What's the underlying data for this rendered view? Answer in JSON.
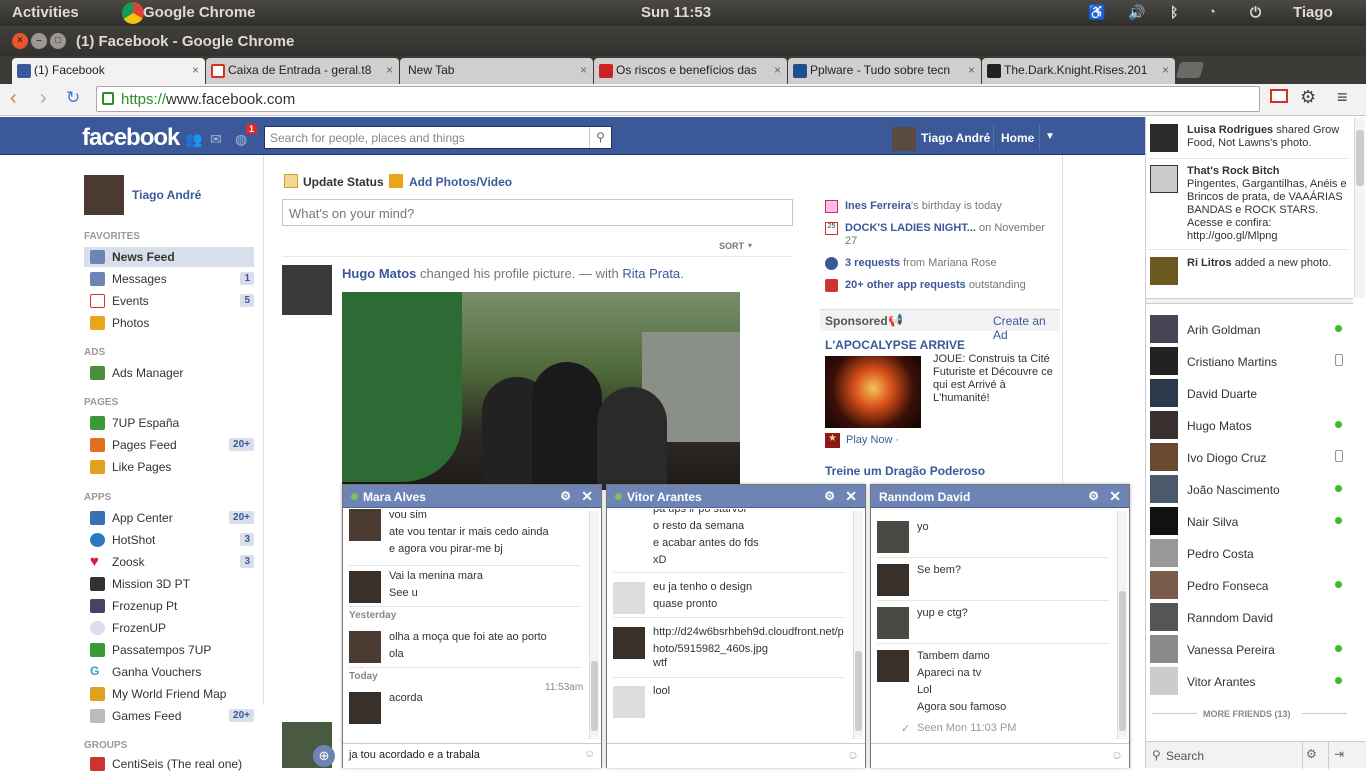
{
  "os_panel": {
    "activities": "Activities",
    "app": "Google Chrome",
    "clock": "Sun 11:53",
    "user": "Tiago"
  },
  "window": {
    "title": "(1) Facebook - Google Chrome"
  },
  "tabs": [
    {
      "label": "(1) Facebook",
      "color": "#3b5998"
    },
    {
      "label": "Caixa de Entrada - geral.t8",
      "color": "#d93025"
    },
    {
      "label": "New Tab",
      "color": ""
    },
    {
      "label": "Os riscos e benefícios das",
      "color": "#cc2222"
    },
    {
      "label": "Pplware - Tudo sobre tecn",
      "color": "#1f4e8c"
    },
    {
      "label": "The.Dark.Knight.Rises.201",
      "color": "#222222"
    }
  ],
  "omnibox": {
    "scheme": "https://",
    "host": "www.facebook.com"
  },
  "fb": {
    "logo": "facebook",
    "notif_count": "1",
    "search_placeholder": "Search for people, places and things",
    "user_name": "Tiago André",
    "home": "Home"
  },
  "left_nav": {
    "profile": "Tiago André",
    "favorites_head": "FAVORITES",
    "favorites": [
      {
        "label": "News Feed",
        "count": "",
        "color": "#6d84b4"
      },
      {
        "label": "Messages",
        "count": "1",
        "color": "#6d84b4"
      },
      {
        "label": "Events",
        "count": "5",
        "color": "#c33"
      },
      {
        "label": "Photos",
        "count": "",
        "color": "#e9a51c"
      }
    ],
    "ads_head": "ADS",
    "ads": [
      {
        "label": "Ads Manager",
        "count": "",
        "color": "#4b8f3c"
      }
    ],
    "pages_head": "PAGES",
    "pages": [
      {
        "label": "7UP España",
        "count": "",
        "color": "#3a9a3a"
      },
      {
        "label": "Pages Feed",
        "count": "20+",
        "color": "#e07020"
      },
      {
        "label": "Like Pages",
        "count": "",
        "color": "#e0a020"
      }
    ],
    "apps_head": "APPS",
    "apps": [
      {
        "label": "App Center",
        "count": "20+",
        "color": "#3b6fb6"
      },
      {
        "label": "HotShot",
        "count": "3",
        "color": "#2a7ac0"
      },
      {
        "label": "Zoosk",
        "count": "3",
        "color": "#d42040"
      },
      {
        "label": "Mission 3D PT",
        "count": "",
        "color": "#333"
      },
      {
        "label": "Frozenup Pt",
        "count": "",
        "color": "#446"
      },
      {
        "label": "FrozenUP",
        "count": "",
        "color": "#aab"
      },
      {
        "label": "Passatempos 7UP",
        "count": "",
        "color": "#3a9a3a"
      },
      {
        "label": "Ganha Vouchers",
        "count": "",
        "color": "#2aa0d8"
      },
      {
        "label": "My World Friend Map",
        "count": "",
        "color": "#e0a020"
      },
      {
        "label": "Games Feed",
        "count": "20+",
        "color": "#888"
      }
    ],
    "groups_head": "GROUPS",
    "groups": [
      {
        "label": "CentiSeis (The real one)",
        "count": "",
        "color": "#c33"
      }
    ]
  },
  "composer": {
    "update_status": "Update Status",
    "add_photos": "Add Photos/Video",
    "placeholder": "What's on your mind?",
    "sort": "SORT"
  },
  "post": {
    "author": "Hugo Matos",
    "action": "changed his profile picture. — with",
    "tagged": "Rita Prata",
    "tail": "."
  },
  "right_col": {
    "birthday_name": "Ines Ferreira",
    "birthday_text": "'s birthday is today",
    "event_name": "DOCK'S LADIES NIGHT...",
    "event_text": "on November 27",
    "requests_count": "3 requests",
    "requests_from": "from Mariana Rose",
    "app_requests": "20+ other app requests",
    "app_requests_tail": "outstanding",
    "sponsored": "Sponsored",
    "create_ad": "Create an Ad",
    "ad1_title": "L'APOCALYPSE ARRIVE",
    "ad1_text": "JOUE: Construis ta Cité Futuriste et Découvre ce qui est Arrivé à L'humanité!",
    "ad1_cta": "Play Now ·",
    "ad2_title": "Treine um Dragão Poderoso"
  },
  "chat1": {
    "name": "Mara Alves",
    "lines_a": [
      "vou sim",
      "ate vou tentar ir mais cedo ainda",
      "e agora vou pirar-me bj"
    ],
    "lines_b": [
      "Vai la menina mara",
      "See u"
    ],
    "day1": "Yesterday",
    "lines_c": [
      "olha a moça que foi ate ao porto",
      "ola"
    ],
    "day2": "Today",
    "time": "11:53am",
    "lines_d": [
      "acorda"
    ],
    "input": "ja tou acordado e a trabala"
  },
  "chat2": {
    "name": "Vitor Arantes",
    "lines_a": [
      "pa ups ir po starvol",
      "o resto da semana",
      "e acabar antes do fds",
      "xD"
    ],
    "lines_b": [
      "eu ja tenho o design",
      "quase pronto"
    ],
    "link": "http://d24w6bsrhbeh9d.cloudfront.net/photo/5915982_460s.jpg",
    "link_l1": "http://d24w6bsrhbeh9d.cloudfront.net/p",
    "link_l2": "hoto/5915982_460s.jpg",
    "wtf": "wtf",
    "lines_c": [
      "lool"
    ]
  },
  "chat3": {
    "name": "Ranndom David",
    "m1": "yo",
    "m2": "Se bem?",
    "m3": "yup e ctg?",
    "lines_d": [
      "Tambem damo",
      "Apareci na tv",
      "Lol",
      "Agora sou famoso"
    ],
    "seen": "Seen Mon 11:03 PM"
  },
  "ticker": [
    {
      "name": "Luisa Rodrigues",
      "text": "shared Grow Food, Not Lawns's photo."
    },
    {
      "name": "That's Rock Bitch",
      "text": "Pingentes, Gargantilhas, Anéis e Brincos de prata, de VAAÁRIAS BANDAS e ROCK STARS. Acesse e confira: http://goo.gl/Mlpng"
    },
    {
      "name": "Ri Litros",
      "text": "added a new photo."
    }
  ],
  "friends": [
    {
      "name": "Arih Goldman",
      "status": "online"
    },
    {
      "name": "Cristiano Martins",
      "status": "mobile"
    },
    {
      "name": "David Duarte",
      "status": ""
    },
    {
      "name": "Hugo Matos",
      "status": "online"
    },
    {
      "name": "Ivo Diogo Cruz",
      "status": "mobile"
    },
    {
      "name": "João Nascimento",
      "status": "online"
    },
    {
      "name": "Nair Silva",
      "status": "online"
    },
    {
      "name": "Pedro Costa",
      "status": ""
    },
    {
      "name": "Pedro Fonseca",
      "status": "online"
    },
    {
      "name": "Ranndom David",
      "status": ""
    },
    {
      "name": "Vanessa Pereira",
      "status": "online"
    },
    {
      "name": "Vitor Arantes",
      "status": "online"
    }
  ],
  "more_friends": "MORE FRIENDS (13)",
  "sidebar_search": "Search"
}
